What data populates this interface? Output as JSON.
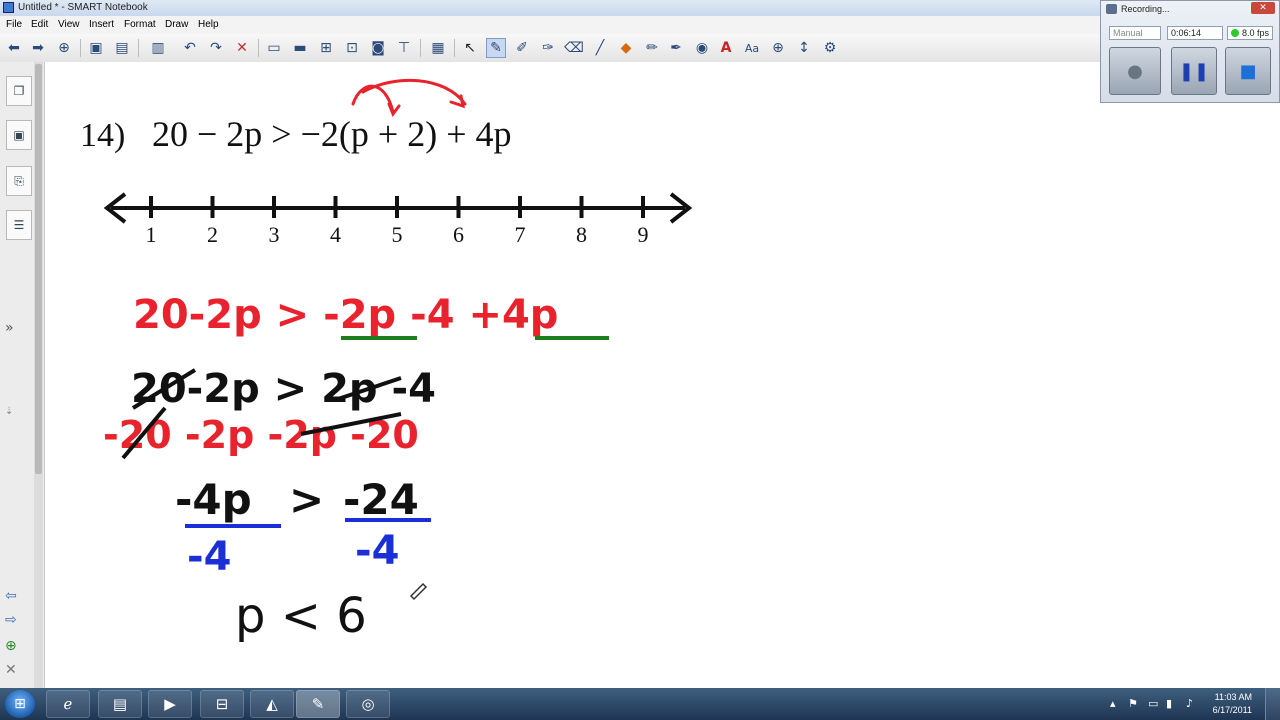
{
  "window": {
    "title": "Untitled * - SMART Notebook"
  },
  "menu": [
    "File",
    "Edit",
    "View",
    "Insert",
    "Format",
    "Draw",
    "Help"
  ],
  "toolbar_icons": [
    "back-icon",
    "forward-icon",
    "add-page-icon",
    "open-icon",
    "save-icon",
    "paste-icon",
    "undo-icon",
    "redo-icon",
    "delete-icon",
    "screen-shade-icon",
    "display-icon",
    "capture-icon",
    "camera-icon",
    "properties-icon",
    "table-icon",
    "select-icon",
    "pen-icon",
    "creative-pen-icon",
    "magic-pen-icon",
    "eraser-icon",
    "line-icon",
    "shape-icon",
    "fill-icon",
    "shape-recognition-icon",
    "text-icon",
    "font-icon",
    "move-icon",
    "more-tools-icon"
  ],
  "problem": {
    "label": "14)",
    "expression": "20 − 2p > −2(p + 2) + 4p"
  },
  "number_line": {
    "ticks": [
      "1",
      "2",
      "3",
      "4",
      "5",
      "6",
      "7",
      "8",
      "9"
    ]
  },
  "handwriting": {
    "line1": "20-2p > -2p -4 +4p",
    "line2": "20-2p > 2p -4",
    "line3": "-20 -2p -2p -20",
    "line4_left": "-4p",
    "line4_op": ">",
    "line4_right": "-24",
    "line5_left": "-4",
    "line5_right": "-4",
    "answer": "p < 6"
  },
  "colors": {
    "red": "#e8232d",
    "green": "#1e7d1e",
    "blue": "#1a2fd6",
    "black": "#111111"
  },
  "recorder": {
    "title": "Recording...",
    "mode": "Manual",
    "elapsed": "0:06:14",
    "fps": "8.0 fps"
  },
  "taskbar": {
    "apps": [
      "ie-icon",
      "explorer-icon",
      "media-player-icon",
      "network-icon",
      "pdf-icon",
      "notebook-icon",
      "recorder-icon"
    ],
    "time": "11:03 AM",
    "date": "6/17/2011"
  }
}
